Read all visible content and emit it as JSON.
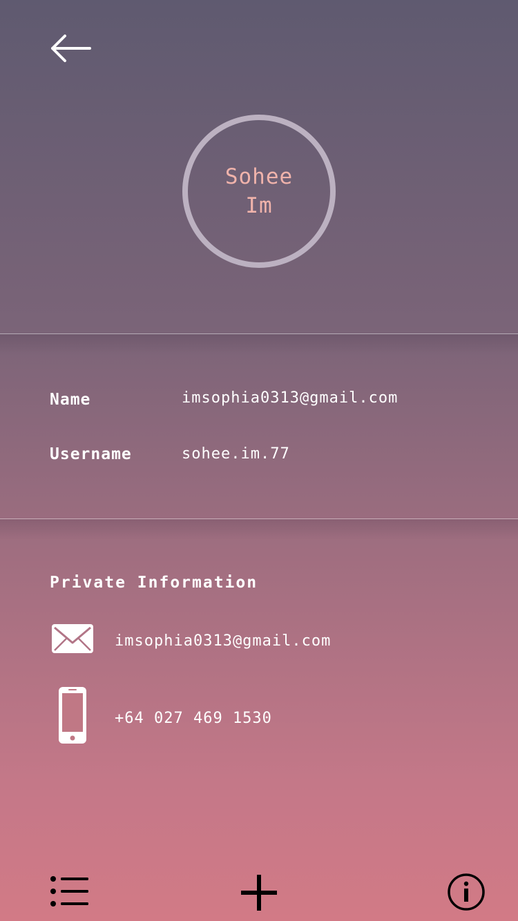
{
  "header": {
    "back_icon": "arrow-left-icon"
  },
  "avatar": {
    "first_name": "Sohee",
    "last_name": "Im"
  },
  "account": {
    "name_label": "Name",
    "name_value": "imsophia0313@gmail.com",
    "username_label": "Username",
    "username_value": "sohee.im.77"
  },
  "private": {
    "title": "Private Information",
    "email_icon": "envelope-icon",
    "email": "imsophia0313@gmail.com",
    "phone_icon": "smartphone-icon",
    "phone": "+64 027 469 1530"
  },
  "toolbar": {
    "list_icon": "list-icon",
    "add_icon": "plus-icon",
    "info_icon": "info-icon"
  }
}
